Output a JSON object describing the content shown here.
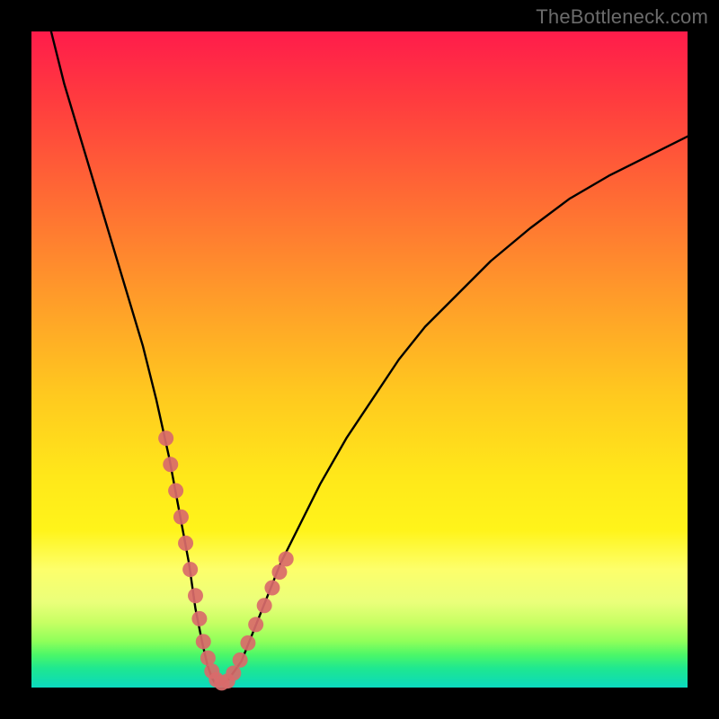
{
  "watermark": "TheBottleneck.com",
  "chart_data": {
    "type": "line",
    "title": "",
    "xlabel": "",
    "ylabel": "",
    "xlim": [
      0,
      100
    ],
    "ylim": [
      0,
      100
    ],
    "grid": false,
    "legend": false,
    "series": [
      {
        "name": "curve",
        "color": "#000000",
        "x": [
          3,
          5,
          8,
          11,
          14,
          17,
          19,
          21,
          22.5,
          24,
          25,
          26,
          26.8,
          27.5,
          28,
          29,
          30,
          32,
          34,
          36,
          38,
          41,
          44,
          48,
          52,
          56,
          60,
          65,
          70,
          76,
          82,
          88,
          94,
          100
        ],
        "y": [
          100,
          92,
          82,
          72,
          62,
          52,
          44,
          35,
          27,
          19,
          12,
          7,
          3.5,
          1.5,
          0.6,
          0.5,
          1.2,
          4,
          9,
          14,
          19,
          25,
          31,
          38,
          44,
          50,
          55,
          60,
          65,
          70,
          74.5,
          78,
          81,
          84
        ]
      },
      {
        "name": "datapoints",
        "color": "#d96a6a",
        "type": "scatter",
        "x": [
          20.5,
          21.2,
          22.0,
          22.8,
          23.5,
          24.2,
          25.0,
          25.6,
          26.2,
          26.9,
          27.5,
          28.2,
          29.0,
          29.9,
          30.8,
          31.8,
          33.0,
          34.2,
          35.5,
          36.7,
          37.8,
          38.8
        ],
        "y": [
          38,
          34,
          30,
          26,
          22,
          18,
          14,
          10.5,
          7,
          4.5,
          2.5,
          1.2,
          0.7,
          1.0,
          2.2,
          4.2,
          6.8,
          9.6,
          12.5,
          15.2,
          17.6,
          19.6
        ]
      }
    ],
    "notes": "Background is a vertical heat gradient from red (top) through orange/yellow to green (bottom). The black curve is V-shaped with minimum near x≈28. Salmon scatter points cluster along the lower part of the V (roughly x 20–39)."
  }
}
